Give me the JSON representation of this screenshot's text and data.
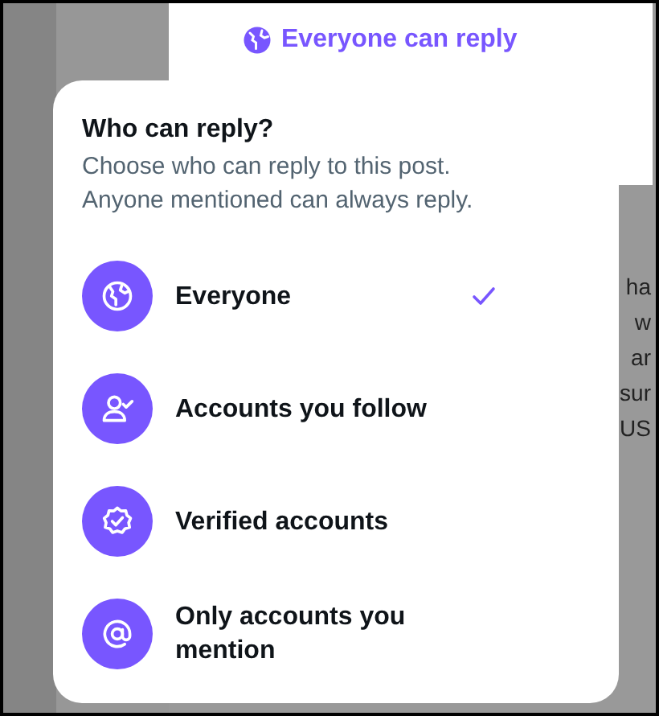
{
  "reply_setting": {
    "label": "Everyone can reply"
  },
  "background_fragments": [
    "ha",
    "w",
    "ar",
    "sur",
    "US"
  ],
  "popup": {
    "title": "Who can reply?",
    "description": [
      "Choose who can reply to this post.",
      "Anyone mentioned can always reply."
    ],
    "options": [
      {
        "kind": "globe",
        "label": "Everyone",
        "selected": true
      },
      {
        "kind": "follow",
        "label": "Accounts you follow",
        "selected": false
      },
      {
        "kind": "verified",
        "label": "Verified accounts",
        "selected": false
      },
      {
        "kind": "mention",
        "label": "Only accounts you mention",
        "selected": false
      }
    ]
  }
}
